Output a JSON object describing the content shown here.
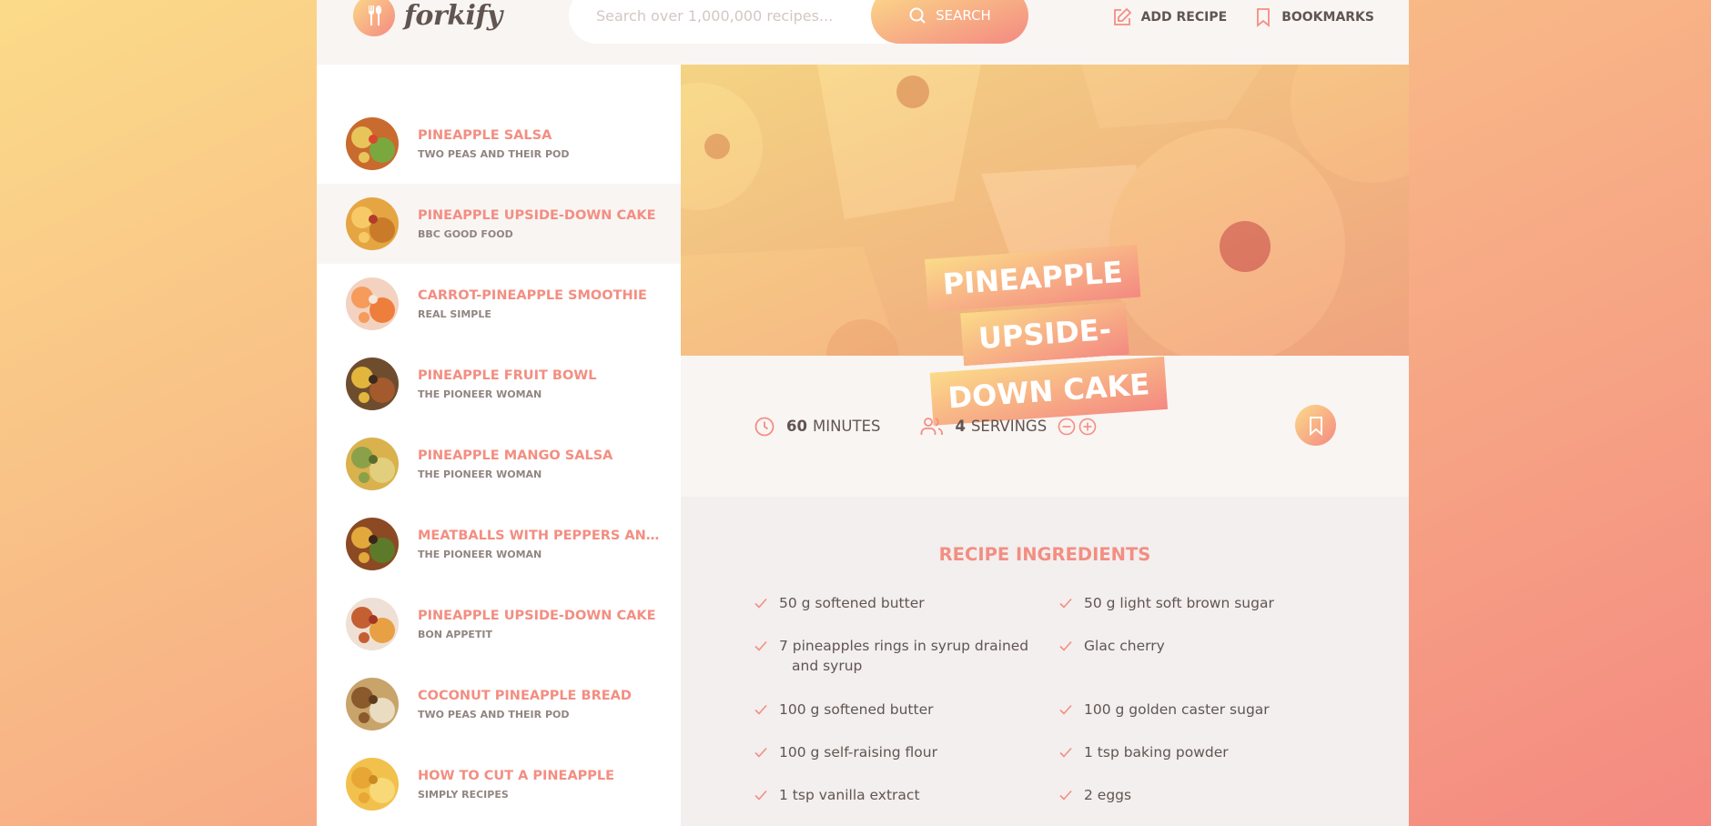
{
  "header": {
    "logo_text": "forkify",
    "search_placeholder": "Search over 1,000,000 recipes...",
    "search_button": "Search",
    "nav": [
      {
        "label": "Add recipe",
        "icon": "edit-icon"
      },
      {
        "label": "Bookmarks",
        "icon": "bookmark-icon"
      }
    ]
  },
  "results": [
    {
      "title": "Pineapple Salsa",
      "publisher": "Two Peas and Their Pod",
      "active": false,
      "colors": [
        "#c96a2e",
        "#e8c55a",
        "#7aa83e",
        "#d9472e"
      ]
    },
    {
      "title": "Pineapple Upside-Down Cake",
      "publisher": "BBC Good Food",
      "active": true,
      "colors": [
        "#e5a542",
        "#f7c967",
        "#c97b2a",
        "#b33a2a"
      ]
    },
    {
      "title": "Carrot-Pineapple Smoothie",
      "publisher": "Real Simple",
      "active": false,
      "colors": [
        "#f3d2c0",
        "#f59b5b",
        "#ee7e3c",
        "#f7e7dc"
      ]
    },
    {
      "title": "Pineapple Fruit Bowl",
      "publisher": "The Pioneer Woman",
      "active": false,
      "colors": [
        "#6e4d2e",
        "#e2b53d",
        "#a35a2c",
        "#3d2a1f"
      ]
    },
    {
      "title": "Pineapple Mango Salsa",
      "publisher": "The Pioneer Woman",
      "active": false,
      "colors": [
        "#d9b24e",
        "#8aa14a",
        "#e2cf7d",
        "#5b6b2b"
      ]
    },
    {
      "title": "Meatballs with Peppers and ...",
      "publisher": "The Pioneer Woman",
      "active": false,
      "colors": [
        "#8b4a23",
        "#e3a83c",
        "#5d7a2b",
        "#3a2618"
      ]
    },
    {
      "title": "Pineapple Upside-Down Cake",
      "publisher": "Bon Appetit",
      "active": false,
      "colors": [
        "#efe0d5",
        "#c45f32",
        "#e8a044",
        "#a33524"
      ]
    },
    {
      "title": "Coconut Pineapple Bread",
      "publisher": "Two Peas and Their Pod",
      "active": false,
      "colors": [
        "#c8a46a",
        "#8a5a2c",
        "#e9dcc0",
        "#5e3b1c"
      ]
    },
    {
      "title": "How to Cut a Pineapple",
      "publisher": "Simply Recipes",
      "active": false,
      "colors": [
        "#f2c14d",
        "#e8a734",
        "#f7d977",
        "#c98a22"
      ]
    }
  ],
  "recipe": {
    "title_line1": "Pineapple Upside-",
    "title_line2": "Down Cake",
    "minutes": "60",
    "minutes_label": "minutes",
    "servings": "4",
    "servings_label": "servings",
    "ingredients_heading": "Recipe ingredients",
    "ingredients": [
      "50 g softened butter",
      "50 g light soft brown sugar",
      "7 pineapples rings in syrup drained and syrup",
      " Glac cherry",
      "100 g softened butter",
      "100 g golden caster sugar",
      "100 g self-raising flour",
      "1 tsp baking powder",
      "1 tsp vanilla extract",
      "2 eggs"
    ]
  },
  "colors": {
    "accent": "#f38e82",
    "gradient_start": "#fbdb89",
    "gradient_end": "#f48982",
    "text": "#615551",
    "light_bg": "#f9f5f3"
  }
}
